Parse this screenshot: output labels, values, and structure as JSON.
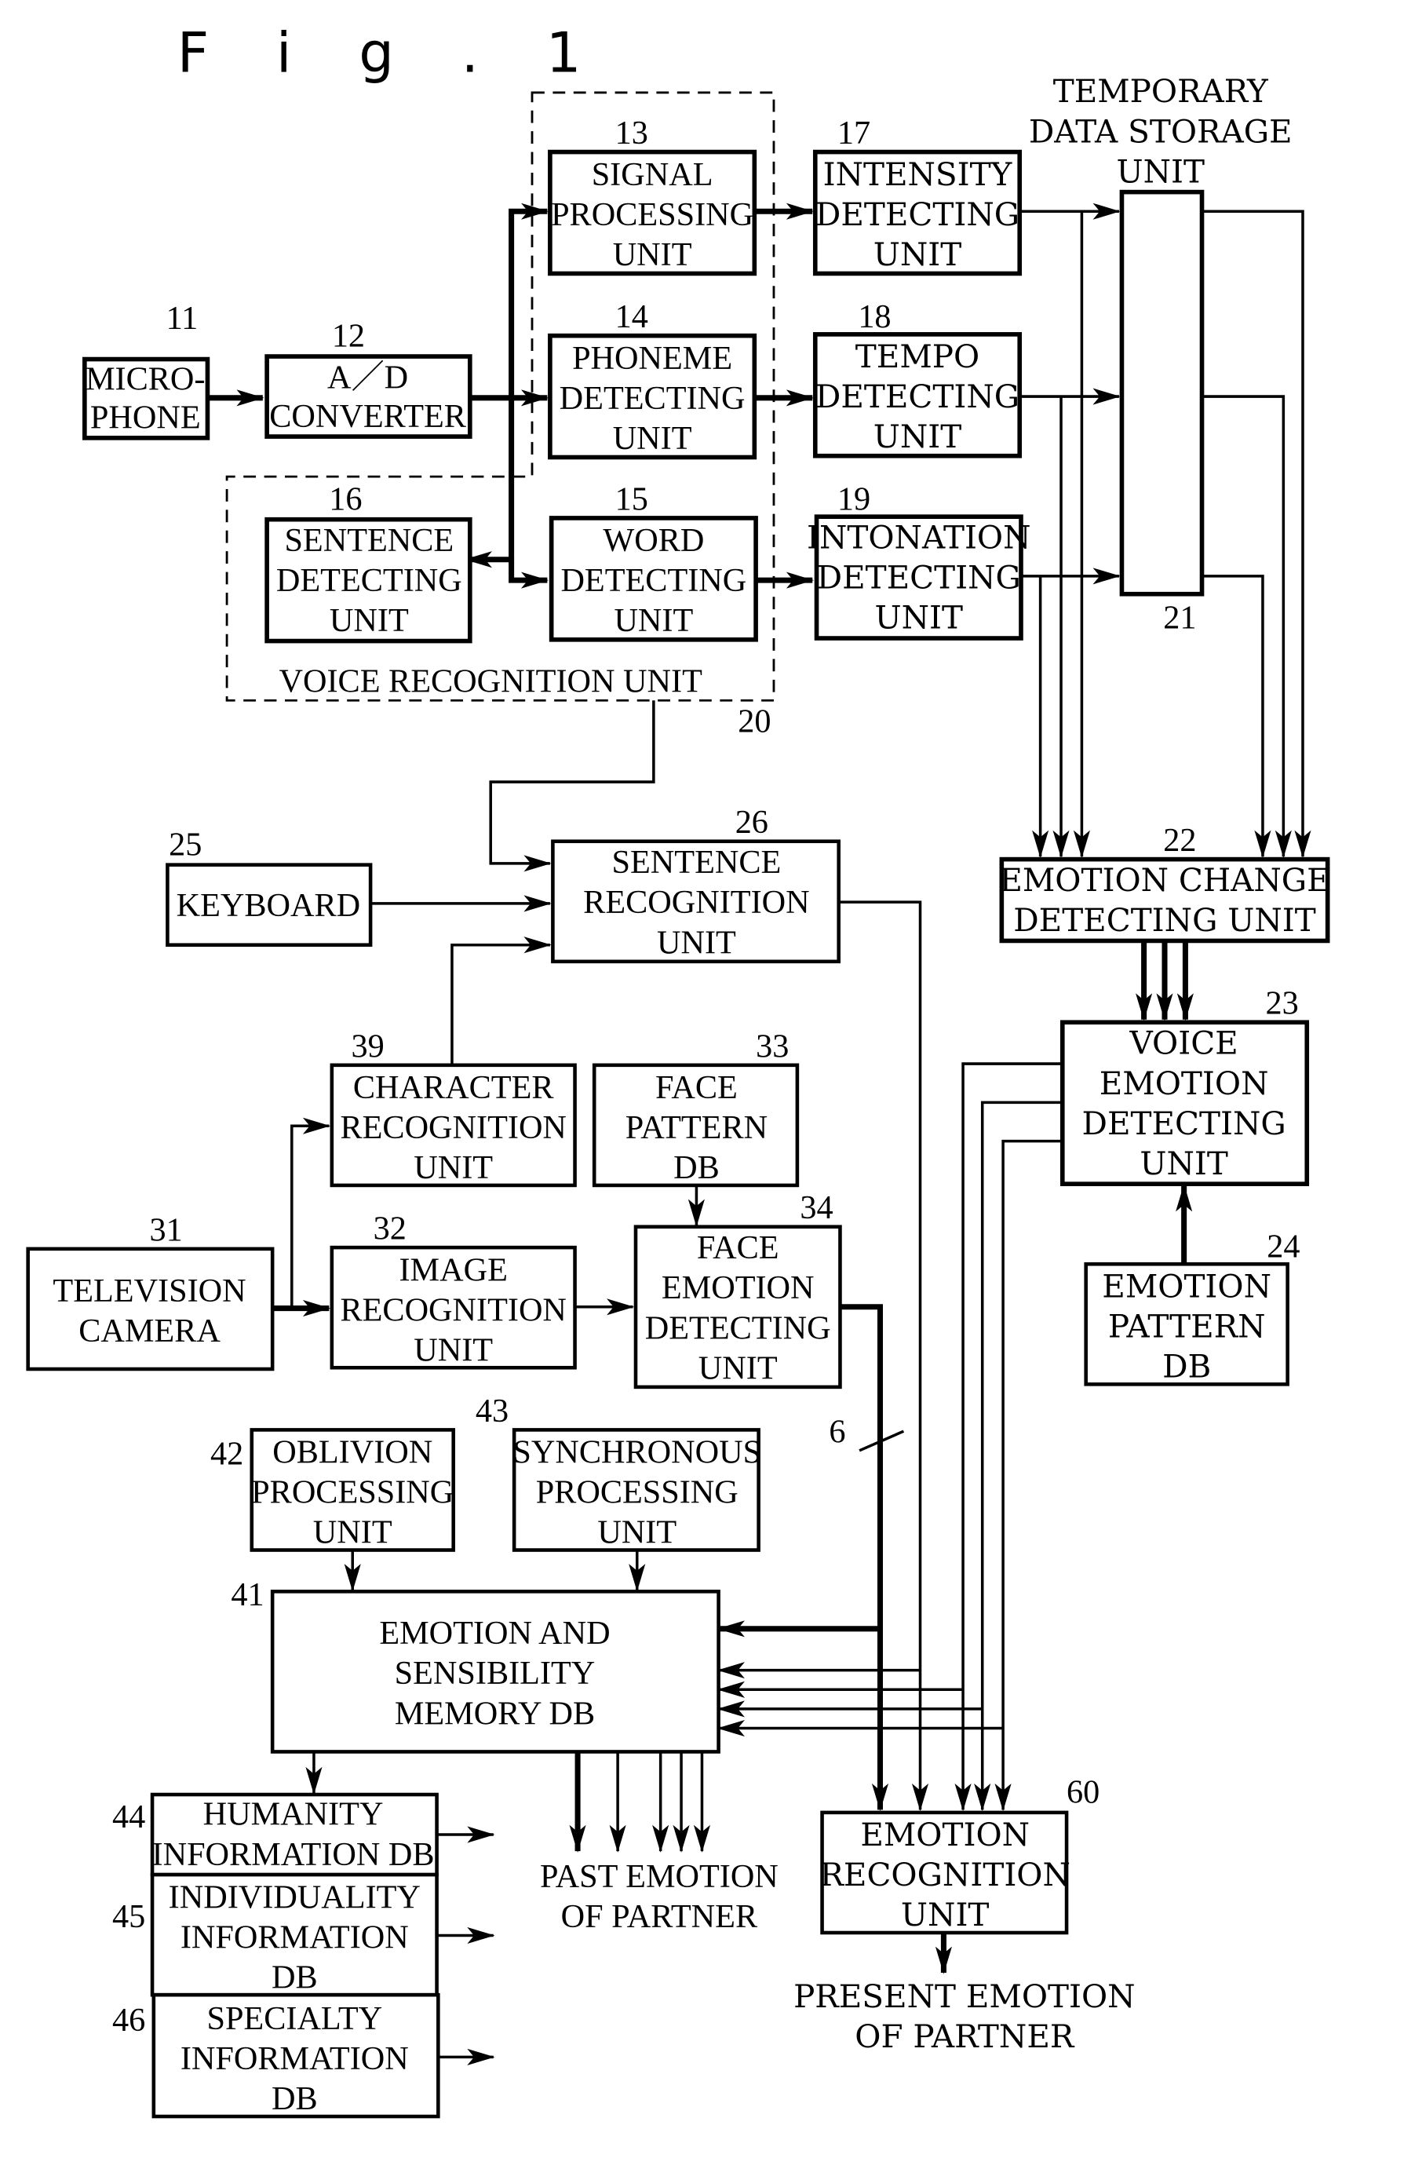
{
  "figure": {
    "title": "F i g . 1",
    "blocks": {
      "microphone": {
        "ref": "11",
        "lines": [
          "MICRO-",
          "PHONE"
        ]
      },
      "ad_converter": {
        "ref": "12",
        "lines": [
          "A／D",
          "CONVERTER"
        ]
      },
      "signal_processing": {
        "ref": "13",
        "lines": [
          "SIGNAL",
          "PROCESSING",
          "UNIT"
        ]
      },
      "phoneme_detecting": {
        "ref": "14",
        "lines": [
          "PHONEME",
          "DETECTING",
          "UNIT"
        ]
      },
      "word_detecting": {
        "ref": "15",
        "lines": [
          "WORD",
          "DETECTING",
          "UNIT"
        ]
      },
      "sentence_detecting": {
        "ref": "16",
        "lines": [
          "SENTENCE",
          "DETECTING",
          "UNIT"
        ]
      },
      "intensity_detecting": {
        "ref": "17",
        "lines": [
          "INTENSITY",
          "DETECTING",
          "UNIT"
        ]
      },
      "tempo_detecting": {
        "ref": "18",
        "lines": [
          "TEMPO",
          "DETECTING",
          "UNIT"
        ]
      },
      "intonation_detecting": {
        "ref": "19",
        "lines": [
          "INTONATION",
          "DETECTING",
          "UNIT"
        ]
      },
      "voice_recognition": {
        "ref": "20",
        "label": "VOICE RECOGNITION UNIT"
      },
      "temporary_storage": {
        "ref": "21",
        "lines": [
          "TEMPORARY",
          "DATA STORAGE",
          "UNIT"
        ]
      },
      "emotion_change": {
        "ref": "22",
        "lines": [
          "EMOTION CHANGE",
          "DETECTING UNIT"
        ]
      },
      "voice_emotion": {
        "ref": "23",
        "lines": [
          "VOICE",
          "EMOTION",
          "DETECTING",
          "UNIT"
        ]
      },
      "emotion_pattern_db": {
        "ref": "24",
        "lines": [
          "EMOTION",
          "PATTERN",
          "DB"
        ]
      },
      "keyboard": {
        "ref": "25",
        "lines": [
          "KEYBOARD"
        ]
      },
      "sentence_recognition": {
        "ref": "26",
        "lines": [
          "SENTENCE",
          "RECOGNITION",
          "UNIT"
        ]
      },
      "television_camera": {
        "ref": "31",
        "lines": [
          "TELEVISION",
          "CAMERA"
        ]
      },
      "image_recognition": {
        "ref": "32",
        "lines": [
          "IMAGE",
          "RECOGNITION",
          "UNIT"
        ]
      },
      "face_pattern_db": {
        "ref": "33",
        "lines": [
          "FACE",
          "PATTERN",
          "DB"
        ]
      },
      "face_emotion": {
        "ref": "34",
        "lines": [
          "FACE",
          "EMOTION",
          "DETECTING",
          "UNIT"
        ]
      },
      "character_recognition": {
        "ref": "39",
        "lines": [
          "CHARACTER",
          "RECOGNITION",
          "UNIT"
        ]
      },
      "memory_db": {
        "ref": "41",
        "lines": [
          "EMOTION AND",
          "SENSIBILITY",
          "MEMORY DB"
        ]
      },
      "oblivion_processing": {
        "ref": "42",
        "lines": [
          "OBLIVION",
          "PROCESSING",
          "UNIT"
        ]
      },
      "synchronous_processing": {
        "ref": "43",
        "lines": [
          "SYNCHRONOUS",
          "PROCESSING",
          "UNIT"
        ]
      },
      "humanity_db": {
        "ref": "44",
        "lines": [
          "HUMANITY",
          "INFORMATION DB"
        ]
      },
      "individuality_db": {
        "ref": "45",
        "lines": [
          "INDIVIDUALITY",
          "INFORMATION",
          "DB"
        ]
      },
      "specialty_db": {
        "ref": "46",
        "lines": [
          "SPECIALTY",
          "INFORMATION",
          "DB"
        ]
      },
      "emotion_recognition": {
        "ref": "60",
        "lines": [
          "EMOTION",
          "RECOGNITION",
          "UNIT"
        ]
      }
    },
    "outputs": {
      "past_emotion": [
        "PAST EMOTION",
        "OF PARTNER"
      ],
      "present_emotion": [
        "PRESENT EMOTION",
        "OF PARTNER"
      ]
    },
    "bus_width_label": "6"
  }
}
